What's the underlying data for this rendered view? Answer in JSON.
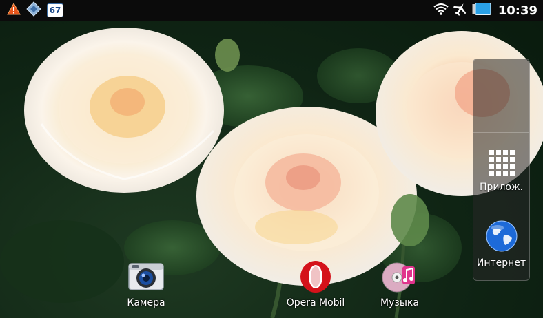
{
  "status_bar": {
    "time": "10:39",
    "notification_badge": "67",
    "icons": [
      "warning-icon",
      "diamond-app-icon",
      "wifi-icon",
      "airplane-mode-icon",
      "battery-icon"
    ]
  },
  "home": {
    "shortcuts": [
      {
        "label": "Камера",
        "icon": "camera-icon"
      },
      {
        "label": "Opera Mobil",
        "icon": "opera-icon"
      },
      {
        "label": "Музыка",
        "icon": "music-icon"
      }
    ]
  },
  "dock": {
    "apps_label": "Прилож.",
    "internet_label": "Интернет"
  },
  "colors": {
    "statusbar_bg": "#0b0b0b",
    "opera_red": "#d4121a",
    "battery_blue": "#2aa0e6"
  }
}
